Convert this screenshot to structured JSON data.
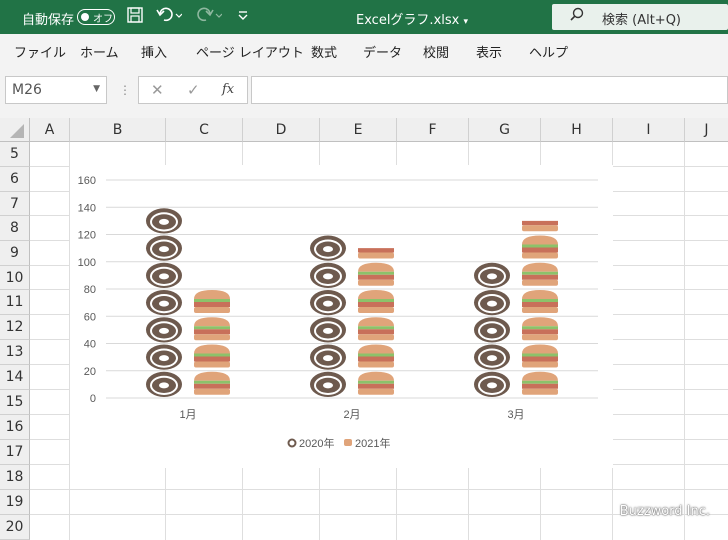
{
  "titlebar": {
    "autosave_label": "自動保存",
    "autosave_state": "オフ",
    "file_name": "Excelグラフ.xlsx",
    "search_placeholder": "検索 (Alt+Q)"
  },
  "menu": [
    "ファイル",
    "ホーム",
    "挿入",
    "ページ レイアウト",
    "数式",
    "データ",
    "校閲",
    "表示",
    "ヘルプ"
  ],
  "formula_bar": {
    "name_box": "M26",
    "fx_label": "fx",
    "formula": ""
  },
  "columns": [
    "A",
    "B",
    "C",
    "D",
    "E",
    "F",
    "G",
    "H",
    "I",
    "J"
  ],
  "rows": [
    "5",
    "6",
    "7",
    "8",
    "9",
    "10",
    "11",
    "12",
    "13",
    "14",
    "15",
    "16",
    "17",
    "18",
    "19",
    "20"
  ],
  "chart_data": {
    "type": "bar",
    "categories": [
      "1月",
      "2月",
      "3月"
    ],
    "series": [
      {
        "name": "2020年",
        "values": [
          140,
          120,
          100
        ],
        "picture": "donut"
      },
      {
        "name": "2021年",
        "values": [
          80,
          110,
          130
        ],
        "picture": "burger"
      }
    ],
    "ylim": [
      0,
      160
    ],
    "yticks": [
      0,
      20,
      40,
      60,
      80,
      100,
      120,
      140,
      160
    ],
    "grid": true,
    "legend": "bottom",
    "colors": {
      "donut": "#6e5a4e",
      "burger_bun": "#e0a47a"
    }
  },
  "watermark": "Buzzword Inc."
}
